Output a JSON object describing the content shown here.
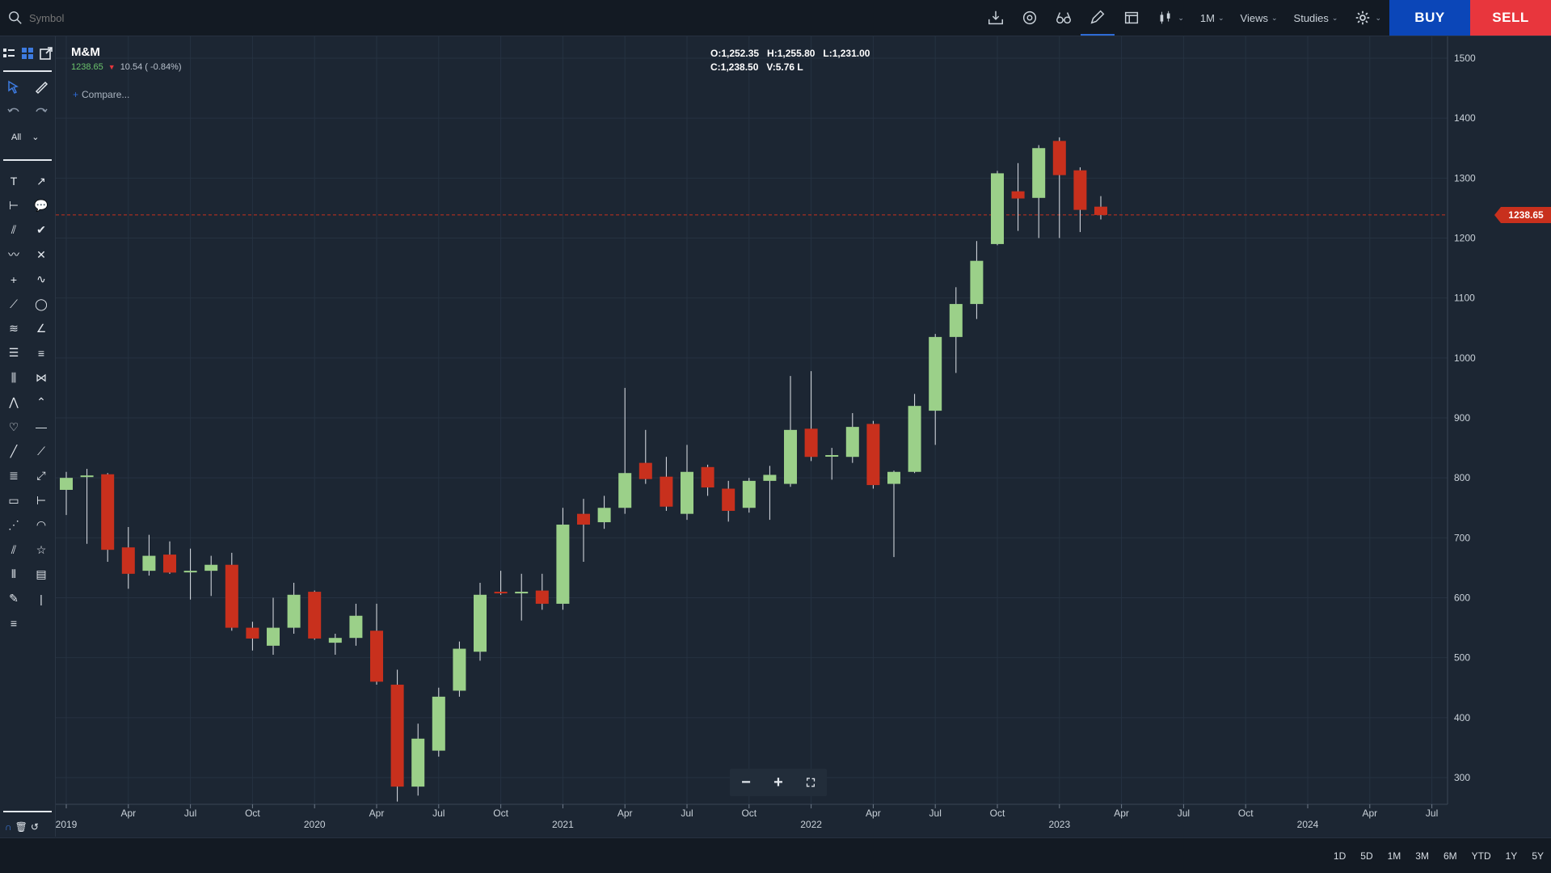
{
  "toolbar": {
    "symbol_placeholder": "Symbol",
    "interval_label": "1M",
    "views_label": "Views",
    "studies_label": "Studies",
    "buy_label": "BUY",
    "sell_label": "SELL"
  },
  "sidebar": {
    "filter_label": "All"
  },
  "quote": {
    "symbol": "M&M",
    "price": "1238.65",
    "change": "10.54 ( -0.84%)",
    "compare_label": "Compare...",
    "ohlc": {
      "open": "O:1,252.35",
      "high": "H:1,255.80",
      "low": "L:1,231.00",
      "close": "C:1,238.50",
      "volume": "V:5.76 L"
    },
    "last_price_tag": "1238.65"
  },
  "ranges": [
    "1D",
    "5D",
    "1M",
    "3M",
    "6M",
    "YTD",
    "1Y",
    "5Y"
  ],
  "colors": {
    "up": "#9bd089",
    "down": "#c8301d",
    "background": "#1c2633",
    "grid": "#263241",
    "last_price": "#c8301d"
  },
  "chart_data": {
    "type": "candlestick",
    "interval": "monthly",
    "ylim": [
      260,
      1530
    ],
    "y_ticks": [
      300,
      400,
      500,
      600,
      700,
      800,
      900,
      1000,
      1100,
      1200,
      1300,
      1400,
      1500
    ],
    "last_price": 1238.65,
    "x_month_labels": [
      "Apr",
      "Jul",
      "Oct",
      "Apr",
      "Jul",
      "Oct",
      "Apr",
      "Jul",
      "Oct",
      "Apr",
      "Jul",
      "Oct",
      "Apr",
      "Jul",
      "Oct",
      "Apr",
      "Jul",
      "Oct",
      "Apr",
      "Jul"
    ],
    "x_year_labels": [
      "2019",
      "2020",
      "2021",
      "2022",
      "2023",
      "2024"
    ],
    "candles": [
      {
        "date": "2019-01",
        "o": 780,
        "h": 810,
        "l": 738,
        "c": 800
      },
      {
        "date": "2019-02",
        "o": 802,
        "h": 815,
        "l": 690,
        "c": 804
      },
      {
        "date": "2019-03",
        "o": 806,
        "h": 808,
        "l": 660,
        "c": 680
      },
      {
        "date": "2019-04",
        "o": 684,
        "h": 718,
        "l": 615,
        "c": 640
      },
      {
        "date": "2019-05",
        "o": 645,
        "h": 705,
        "l": 637,
        "c": 670
      },
      {
        "date": "2019-06",
        "o": 672,
        "h": 694,
        "l": 640,
        "c": 642
      },
      {
        "date": "2019-07",
        "o": 645,
        "h": 682,
        "l": 597,
        "c": 645
      },
      {
        "date": "2019-08",
        "o": 645,
        "h": 670,
        "l": 603,
        "c": 655
      },
      {
        "date": "2019-09",
        "o": 655,
        "h": 675,
        "l": 545,
        "c": 550
      },
      {
        "date": "2019-10",
        "o": 550,
        "h": 560,
        "l": 512,
        "c": 532
      },
      {
        "date": "2019-11",
        "o": 520,
        "h": 600,
        "l": 505,
        "c": 550
      },
      {
        "date": "2019-12",
        "o": 550,
        "h": 625,
        "l": 540,
        "c": 605
      },
      {
        "date": "2020-01",
        "o": 610,
        "h": 612,
        "l": 530,
        "c": 532
      },
      {
        "date": "2020-02",
        "o": 525,
        "h": 540,
        "l": 505,
        "c": 533
      },
      {
        "date": "2020-03",
        "o": 533,
        "h": 590,
        "l": 520,
        "c": 570
      },
      {
        "date": "2020-04",
        "o": 545,
        "h": 590,
        "l": 455,
        "c": 460
      },
      {
        "date": "2020-05",
        "o": 455,
        "h": 480,
        "l": 260,
        "c": 285
      },
      {
        "date": "2020-06",
        "o": 285,
        "h": 390,
        "l": 270,
        "c": 365
      },
      {
        "date": "2020-07",
        "o": 345,
        "h": 450,
        "l": 335,
        "c": 435
      },
      {
        "date": "2020-08",
        "o": 445,
        "h": 527,
        "l": 435,
        "c": 515
      },
      {
        "date": "2020-09",
        "o": 510,
        "h": 625,
        "l": 495,
        "c": 605
      },
      {
        "date": "2020-10",
        "o": 610,
        "h": 645,
        "l": 605,
        "c": 608
      },
      {
        "date": "2020-11",
        "o": 608,
        "h": 640,
        "l": 562,
        "c": 610
      },
      {
        "date": "2020-12",
        "o": 612,
        "h": 640,
        "l": 580,
        "c": 590
      },
      {
        "date": "2021-01",
        "o": 590,
        "h": 750,
        "l": 580,
        "c": 722
      },
      {
        "date": "2021-02",
        "o": 740,
        "h": 765,
        "l": 660,
        "c": 722
      },
      {
        "date": "2021-03",
        "o": 726,
        "h": 770,
        "l": 715,
        "c": 750
      },
      {
        "date": "2021-04",
        "o": 750,
        "h": 950,
        "l": 740,
        "c": 808
      },
      {
        "date": "2021-05",
        "o": 825,
        "h": 880,
        "l": 790,
        "c": 798
      },
      {
        "date": "2021-06",
        "o": 802,
        "h": 835,
        "l": 745,
        "c": 752
      },
      {
        "date": "2021-07",
        "o": 740,
        "h": 855,
        "l": 730,
        "c": 810
      },
      {
        "date": "2021-08",
        "o": 818,
        "h": 822,
        "l": 770,
        "c": 784
      },
      {
        "date": "2021-09",
        "o": 782,
        "h": 795,
        "l": 727,
        "c": 745
      },
      {
        "date": "2021-10",
        "o": 750,
        "h": 800,
        "l": 742,
        "c": 795
      },
      {
        "date": "2021-11",
        "o": 795,
        "h": 820,
        "l": 730,
        "c": 805
      },
      {
        "date": "2021-12",
        "o": 790,
        "h": 970,
        "l": 785,
        "c": 880
      },
      {
        "date": "2022-01",
        "o": 882,
        "h": 978,
        "l": 828,
        "c": 835
      },
      {
        "date": "2022-02",
        "o": 838,
        "h": 850,
        "l": 797,
        "c": 838
      },
      {
        "date": "2022-03",
        "o": 835,
        "h": 908,
        "l": 825,
        "c": 885
      },
      {
        "date": "2022-04",
        "o": 890,
        "h": 895,
        "l": 782,
        "c": 788
      },
      {
        "date": "2022-05",
        "o": 790,
        "h": 812,
        "l": 668,
        "c": 810
      },
      {
        "date": "2022-06",
        "o": 810,
        "h": 940,
        "l": 808,
        "c": 920
      },
      {
        "date": "2022-07",
        "o": 912,
        "h": 1040,
        "l": 855,
        "c": 1035
      },
      {
        "date": "2022-08",
        "o": 1035,
        "h": 1118,
        "l": 975,
        "c": 1090
      },
      {
        "date": "2022-09",
        "o": 1090,
        "h": 1195,
        "l": 1065,
        "c": 1162
      },
      {
        "date": "2022-10",
        "o": 1190,
        "h": 1312,
        "l": 1188,
        "c": 1308
      },
      {
        "date": "2022-11",
        "o": 1278,
        "h": 1325,
        "l": 1212,
        "c": 1266
      },
      {
        "date": "2022-12",
        "o": 1267,
        "h": 1355,
        "l": 1200,
        "c": 1350
      },
      {
        "date": "2023-01",
        "o": 1362,
        "h": 1368,
        "l": 1200,
        "c": 1305
      },
      {
        "date": "2023-02",
        "o": 1313,
        "h": 1318,
        "l": 1210,
        "c": 1247
      },
      {
        "date": "2023-03",
        "o": 1252.35,
        "h": 1270,
        "l": 1231,
        "c": 1238.5
      }
    ]
  }
}
